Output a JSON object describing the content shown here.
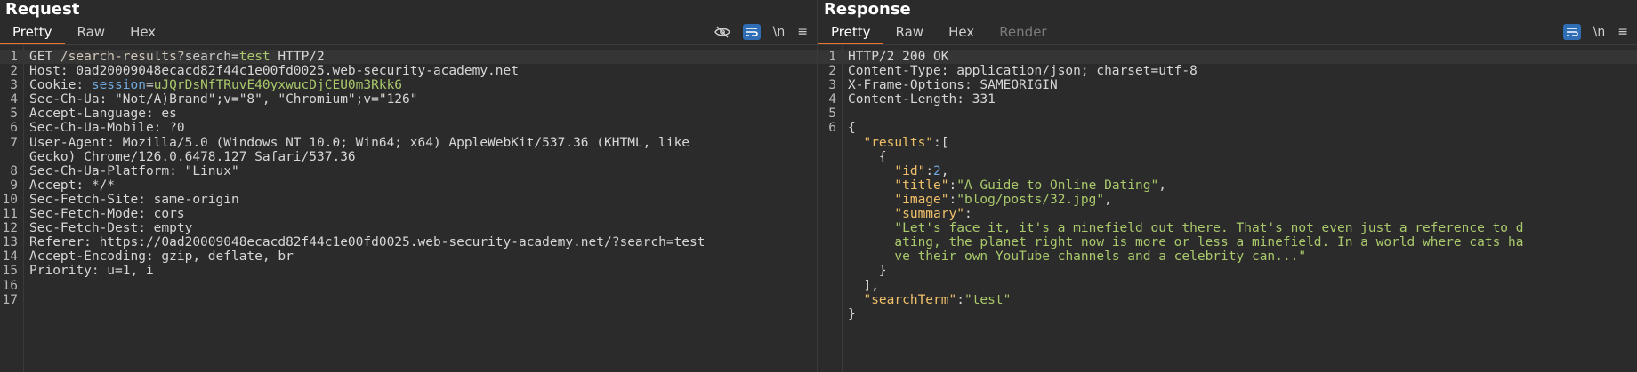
{
  "request": {
    "title": "Request",
    "tabs": [
      "Pretty",
      "Raw",
      "Hex"
    ],
    "lines": [
      {
        "n": "1",
        "parts": [
          {
            "t": "GET ",
            "c": "hname"
          },
          {
            "t": "/search-results?",
            "c": "path"
          },
          {
            "t": "search",
            "c": "param"
          },
          {
            "t": "=",
            "c": "hname"
          },
          {
            "t": "test",
            "c": "green"
          },
          {
            "t": " HTTP/2",
            "c": "hname"
          }
        ]
      },
      {
        "n": "2",
        "parts": [
          {
            "t": "Host: 0ad20009048ecacd82f44c1e00fd0025.web-security-academy.net",
            "c": "hname"
          }
        ]
      },
      {
        "n": "3",
        "parts": [
          {
            "t": "Cookie: ",
            "c": "hname"
          },
          {
            "t": "session",
            "c": "blue"
          },
          {
            "t": "=",
            "c": "hname"
          },
          {
            "t": "uJQrDsNfTRuvE40yxwucDjCEU0m3Rkk6",
            "c": "green"
          }
        ]
      },
      {
        "n": "4",
        "parts": [
          {
            "t": "Sec-Ch-Ua: \"Not/A)Brand\";v=\"8\", \"Chromium\";v=\"126\"",
            "c": "hname"
          }
        ]
      },
      {
        "n": "5",
        "parts": [
          {
            "t": "Accept-Language: es",
            "c": "hname"
          }
        ]
      },
      {
        "n": "6",
        "parts": [
          {
            "t": "Sec-Ch-Ua-Mobile: ?0",
            "c": "hname"
          }
        ]
      },
      {
        "n": "7",
        "parts": [
          {
            "t": "User-Agent: Mozilla/5.0 (Windows NT 10.0; Win64; x64) AppleWebKit/537.36 (KHTML, like",
            "c": "hname"
          }
        ]
      },
      {
        "n": "",
        "parts": [
          {
            "t": "Gecko) Chrome/126.0.6478.127 Safari/537.36",
            "c": "hname"
          }
        ]
      },
      {
        "n": "8",
        "parts": [
          {
            "t": "Sec-Ch-Ua-Platform: \"Linux\"",
            "c": "hname"
          }
        ]
      },
      {
        "n": "9",
        "parts": [
          {
            "t": "Accept: */*",
            "c": "hname"
          }
        ]
      },
      {
        "n": "10",
        "parts": [
          {
            "t": "Sec-Fetch-Site: same-origin",
            "c": "hname"
          }
        ]
      },
      {
        "n": "11",
        "parts": [
          {
            "t": "Sec-Fetch-Mode: cors",
            "c": "hname"
          }
        ]
      },
      {
        "n": "12",
        "parts": [
          {
            "t": "Sec-Fetch-Dest: empty",
            "c": "hname"
          }
        ]
      },
      {
        "n": "13",
        "parts": [
          {
            "t": "Referer: https://0ad20009048ecacd82f44c1e00fd0025.web-security-academy.net/?search=test",
            "c": "hname"
          }
        ]
      },
      {
        "n": "14",
        "parts": [
          {
            "t": "Accept-Encoding: gzip, deflate, br",
            "c": "hname"
          }
        ]
      },
      {
        "n": "15",
        "parts": [
          {
            "t": "Priority: u=1, i",
            "c": "hname"
          }
        ]
      },
      {
        "n": "16",
        "parts": [
          {
            "t": "",
            "c": "hname"
          }
        ]
      },
      {
        "n": "17",
        "parts": [
          {
            "t": "",
            "c": "hname"
          }
        ]
      }
    ]
  },
  "response": {
    "title": "Response",
    "tabs": [
      "Pretty",
      "Raw",
      "Hex",
      "Render"
    ],
    "lines": [
      {
        "n": "1",
        "parts": [
          {
            "t": "HTTP/2 200 OK",
            "c": "hname"
          }
        ]
      },
      {
        "n": "2",
        "parts": [
          {
            "t": "Content-Type: application/json; charset=utf-8",
            "c": "hname"
          }
        ]
      },
      {
        "n": "3",
        "parts": [
          {
            "t": "X-Frame-Options: SAMEORIGIN",
            "c": "hname"
          }
        ]
      },
      {
        "n": "4",
        "parts": [
          {
            "t": "Content-Length: 331",
            "c": "hname"
          }
        ]
      },
      {
        "n": "5",
        "parts": [
          {
            "t": "",
            "c": "hname"
          }
        ]
      },
      {
        "n": "6",
        "parts": [
          {
            "t": "{",
            "c": "hname"
          }
        ]
      },
      {
        "n": "",
        "parts": [
          {
            "t": "  ",
            "c": "hname"
          },
          {
            "t": "\"results\"",
            "c": "key"
          },
          {
            "t": ":[",
            "c": "hname"
          }
        ]
      },
      {
        "n": "",
        "parts": [
          {
            "t": "    {",
            "c": "hname"
          }
        ]
      },
      {
        "n": "",
        "parts": [
          {
            "t": "      ",
            "c": "hname"
          },
          {
            "t": "\"id\"",
            "c": "key"
          },
          {
            "t": ":",
            "c": "hname"
          },
          {
            "t": "2",
            "c": "numval"
          },
          {
            "t": ",",
            "c": "hname"
          }
        ]
      },
      {
        "n": "",
        "parts": [
          {
            "t": "      ",
            "c": "hname"
          },
          {
            "t": "\"title\"",
            "c": "key"
          },
          {
            "t": ":",
            "c": "hname"
          },
          {
            "t": "\"A Guide to Online Dating\"",
            "c": "str"
          },
          {
            "t": ",",
            "c": "hname"
          }
        ]
      },
      {
        "n": "",
        "parts": [
          {
            "t": "      ",
            "c": "hname"
          },
          {
            "t": "\"image\"",
            "c": "key"
          },
          {
            "t": ":",
            "c": "hname"
          },
          {
            "t": "\"blog/posts/32.jpg\"",
            "c": "str"
          },
          {
            "t": ",",
            "c": "hname"
          }
        ]
      },
      {
        "n": "",
        "parts": [
          {
            "t": "      ",
            "c": "hname"
          },
          {
            "t": "\"summary\"",
            "c": "key"
          },
          {
            "t": ":",
            "c": "hname"
          }
        ]
      },
      {
        "n": "",
        "parts": [
          {
            "t": "      ",
            "c": "hname"
          },
          {
            "t": "\"Let's face it, it's a minefield out there. That's not even just a reference to d",
            "c": "str"
          }
        ]
      },
      {
        "n": "",
        "parts": [
          {
            "t": "      ",
            "c": "hname"
          },
          {
            "t": "ating, the planet right now is more or less a minefield. In a world where cats ha",
            "c": "str"
          }
        ]
      },
      {
        "n": "",
        "parts": [
          {
            "t": "      ",
            "c": "hname"
          },
          {
            "t": "ve their own YouTube channels and a celebrity can...\"",
            "c": "str"
          }
        ]
      },
      {
        "n": "",
        "parts": [
          {
            "t": "    }",
            "c": "hname"
          }
        ]
      },
      {
        "n": "",
        "parts": [
          {
            "t": "  ],",
            "c": "hname"
          }
        ]
      },
      {
        "n": "",
        "parts": [
          {
            "t": "  ",
            "c": "hname"
          },
          {
            "t": "\"searchTerm\"",
            "c": "key"
          },
          {
            "t": ":",
            "c": "hname"
          },
          {
            "t": "\"test\"",
            "c": "str"
          }
        ]
      },
      {
        "n": "",
        "parts": [
          {
            "t": "}",
            "c": "hname"
          }
        ]
      }
    ]
  },
  "toolbar": {
    "newline_label": "\\n",
    "menu_label": "≡"
  },
  "colors": {
    "accent": "#e8742e",
    "toggle_on": "#2f6db4"
  }
}
